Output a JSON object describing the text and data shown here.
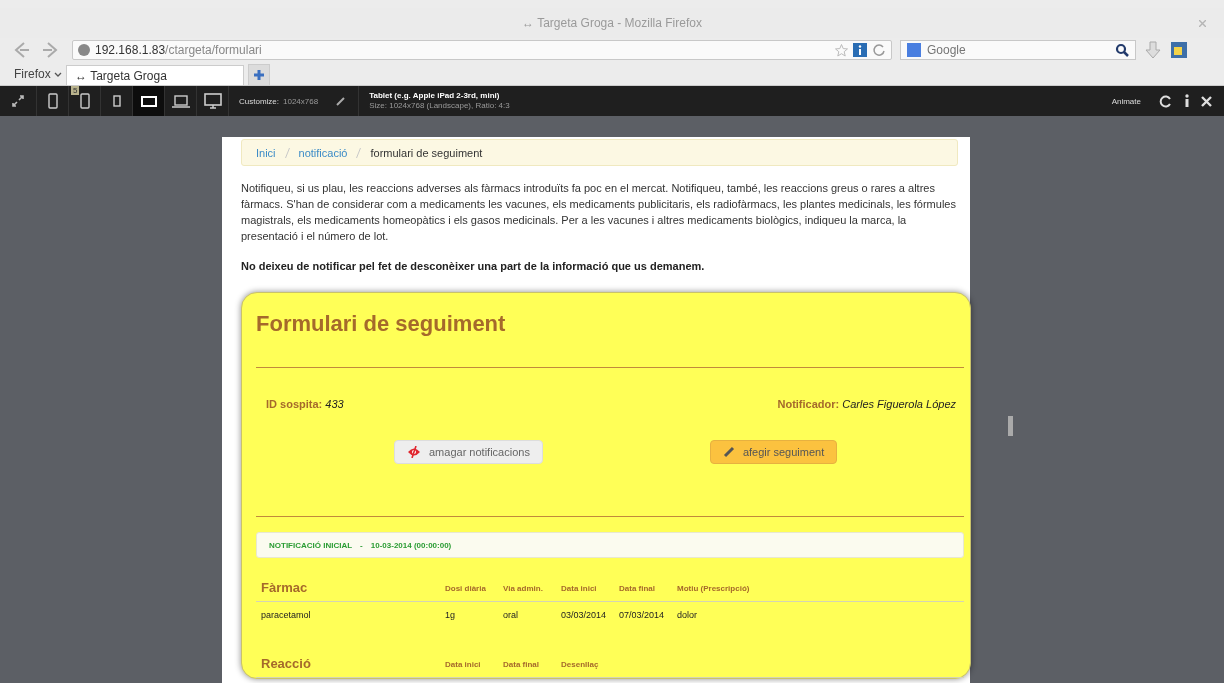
{
  "window": {
    "title": "↔ Targeta Groga - Mozilla Firefox"
  },
  "nav": {
    "url_host": "192.168.1.83",
    "url_path": "/ctargeta/formulari",
    "search_placeholder": "Google"
  },
  "tab_strip": {
    "menu": "Firefox",
    "tabs": [
      {
        "label": "↔ Targeta Groga",
        "selected": true
      }
    ]
  },
  "responsive_bar": {
    "presets": [
      {
        "kind": "phone",
        "selected": false
      },
      {
        "kind": "phone",
        "selected": false,
        "badge": "5"
      },
      {
        "kind": "small",
        "selected": false
      },
      {
        "kind": "tablet",
        "selected": true
      },
      {
        "kind": "laptop",
        "selected": false
      },
      {
        "kind": "desktop",
        "selected": false
      }
    ],
    "customize_label": "Customize:",
    "size": "1024x768",
    "device_name": "Tablet (e.g. Apple iPad 2-3rd, mini)",
    "device_info": "Size: 1024x768 (Landscape), Ratio: 4:3",
    "animate": "Animate"
  },
  "breadcrumb": [
    {
      "label": "Inici",
      "link": true
    },
    {
      "label": "notificació",
      "link": true
    },
    {
      "label": "formulari de seguiment",
      "link": false
    }
  ],
  "intro": "Notifiqueu, si us plau, les reaccions adverses als fàrmacs introduïts fa poc en el mercat. Notifiqueu, també, les reaccions greus o rares a altres fàrmacs. S'han de considerar com a medicaments les vacunes, els medicaments publicitaris, els radiofàrmacs, les plantes medicinals, les fórmules magistrals, els medicaments homeopàtics i els gasos medicinals. Per a les vacunes i altres medicaments biològics, indiqueu la marca, la presentació i el número de lot.",
  "warning": "No deixeu de notificar pel fet de desconèixer una part de la informació que us demanem.",
  "card": {
    "title": "Formulari de seguiment",
    "id_label": "ID sospita:",
    "id_value": "433",
    "notifier_label": "Notificador:",
    "notifier_value": "Carles Figuerola López",
    "buttons": [
      {
        "label": "amagar notificacions",
        "kind": "hide"
      },
      {
        "label": "afegir seguiment",
        "kind": "add"
      }
    ],
    "notification": {
      "label": "NOTIFICACIÓ INICIAL",
      "separator": "-",
      "date": "10-03-2014 (00:00:00)"
    },
    "sections": [
      {
        "title": "Fàrmac",
        "columns": [
          "Dosi diària",
          "Via admin.",
          "Data inici",
          "Data final",
          "Motiu (Prescripció)"
        ],
        "rows": [
          {
            "name": "paracetamol",
            "cells": [
              "1g",
              "oral",
              "03/03/2014",
              "07/03/2014",
              "dolor"
            ]
          }
        ]
      },
      {
        "title": "Reacció",
        "columns": [
          "Data inici",
          "Data final",
          "Desenllaç"
        ]
      }
    ]
  }
}
